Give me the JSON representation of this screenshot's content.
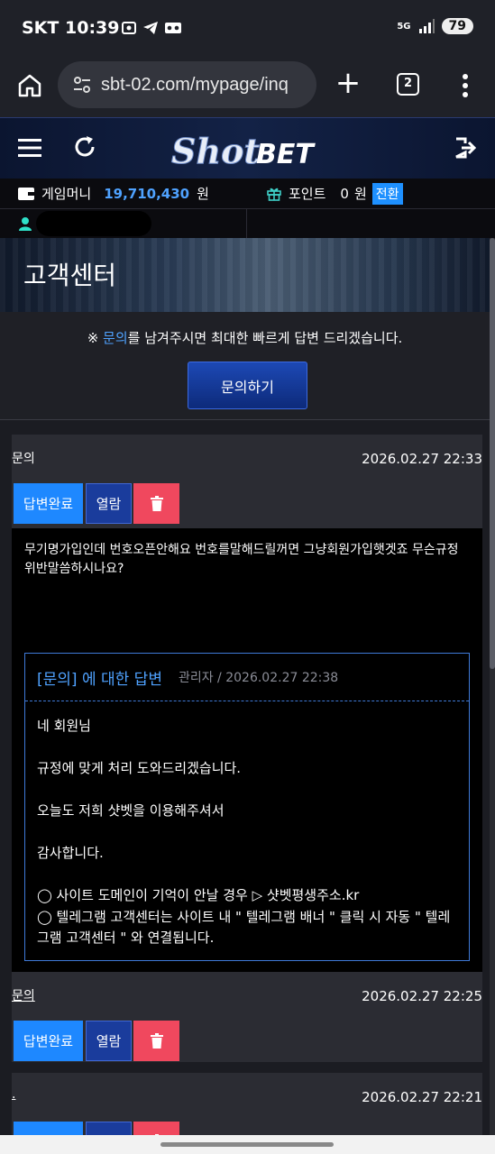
{
  "status": {
    "carrier": "SKT",
    "time": "10:39",
    "battery": "79",
    "network": "5G"
  },
  "browser": {
    "url": "sbt-02.com/mypage/inq",
    "tab_count": "2"
  },
  "header": {
    "logo_text_1": "Shot",
    "logo_text_2": "BET"
  },
  "wallet": {
    "money_label": "게임머니",
    "money_value": "19,710,430",
    "money_unit": "원",
    "point_label": "포인트",
    "point_value": "0",
    "point_unit": "원",
    "convert_label": "전환"
  },
  "banner": {
    "title": "고객센터"
  },
  "notice": {
    "prefix": "※ ",
    "link": "문의",
    "suffix": "를 남겨주시면 최대한 빠르게 답변 드리겠습니다.",
    "button": "문의하기"
  },
  "inquiries": [
    {
      "label": "문의",
      "date": "2026.02.27 22:33",
      "status": "답변완료",
      "view": "열람",
      "question": "무기명가입인데 번호오픈안해요 번호를말해드릴꺼면 그냥회원가입햇겟죠 무슨규정위반말씀하시나요?",
      "answer": {
        "title": "[문의] 에 대한 답변",
        "meta": "관리자 / 2026.02.27 22:38",
        "lines": [
          "네 회원님",
          "규정에 맞게 처리 도와드리겠습니다.",
          "오늘도 저희 샷벳을 이용해주셔서",
          "감사합니다."
        ],
        "note1": "◯ 사이트 도메인이 기억이 안날 경우 ▷ 샷벳평생주소.kr",
        "note2": "◯ 텔레그램 고객센터는 사이트 내 \" 텔레그램 배너 \" 클릭 시 자동 \" 텔레그램 고객센터 \" 와 연결됩니다."
      }
    },
    {
      "label": "문의",
      "date": "2026.02.27 22:25",
      "status": "답변완료",
      "view": "열람"
    },
    {
      "label": ".",
      "date": "2026.02.27 22:21"
    }
  ],
  "colors": {
    "accent": "#1e88ff",
    "link": "#4fa2ff",
    "danger": "#f0485e",
    "header_bg": "#0b1530"
  }
}
